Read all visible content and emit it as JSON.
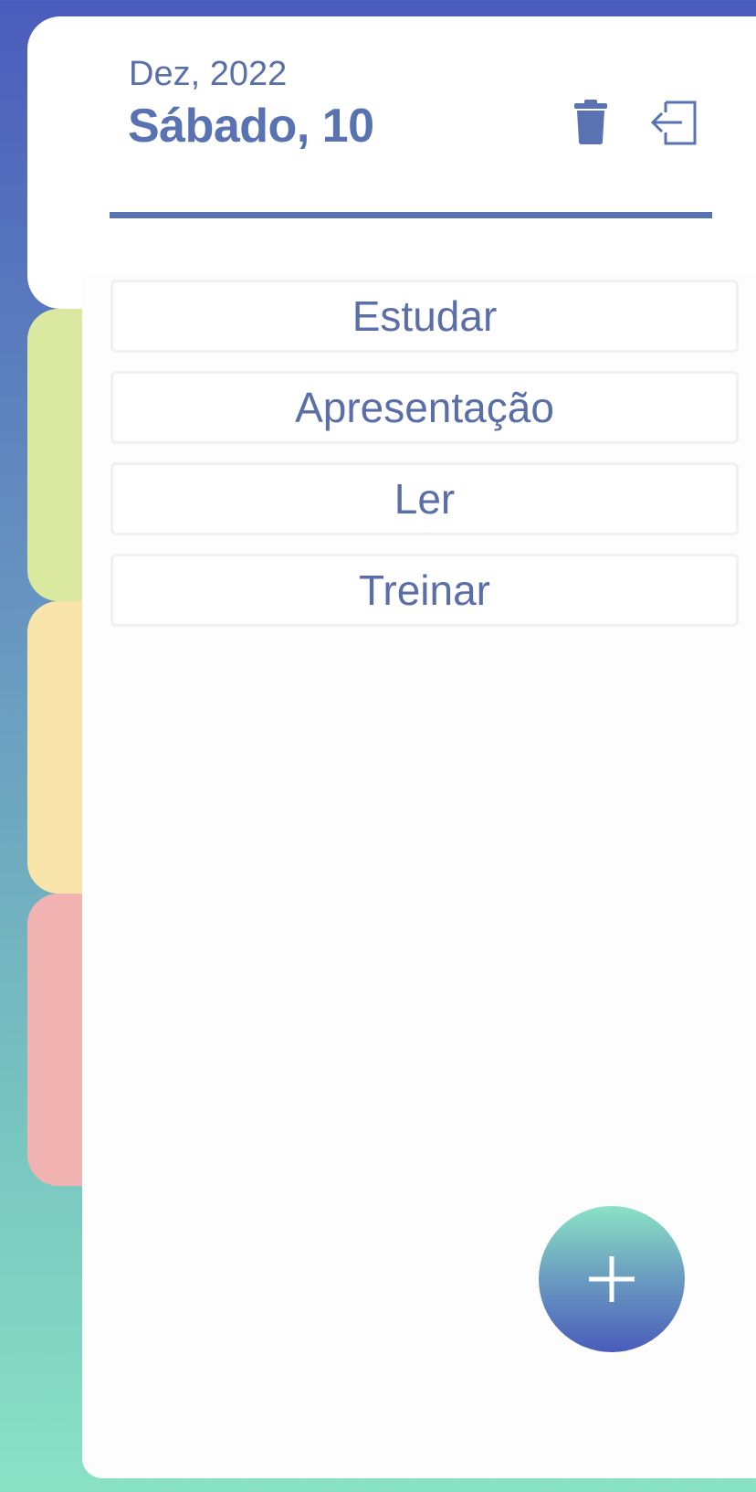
{
  "header": {
    "month": "Dez, 2022",
    "day": "Sábado, 10",
    "delete_icon": "trash-icon",
    "logout_icon": "logout-icon"
  },
  "tabs": [
    {
      "color": "#dbe9a0"
    },
    {
      "color": "#f9e4ab"
    },
    {
      "color": "#f2b3b3"
    }
  ],
  "tasks": [
    {
      "label": "Estudar"
    },
    {
      "label": "Apresentação"
    },
    {
      "label": "Ler"
    },
    {
      "label": "Treinar"
    }
  ],
  "fab": {
    "icon": "plus-icon"
  },
  "colors": {
    "accent": "#5872b2",
    "gradient_top": "#4a5cbb",
    "gradient_bottom": "#8ae2c4"
  }
}
